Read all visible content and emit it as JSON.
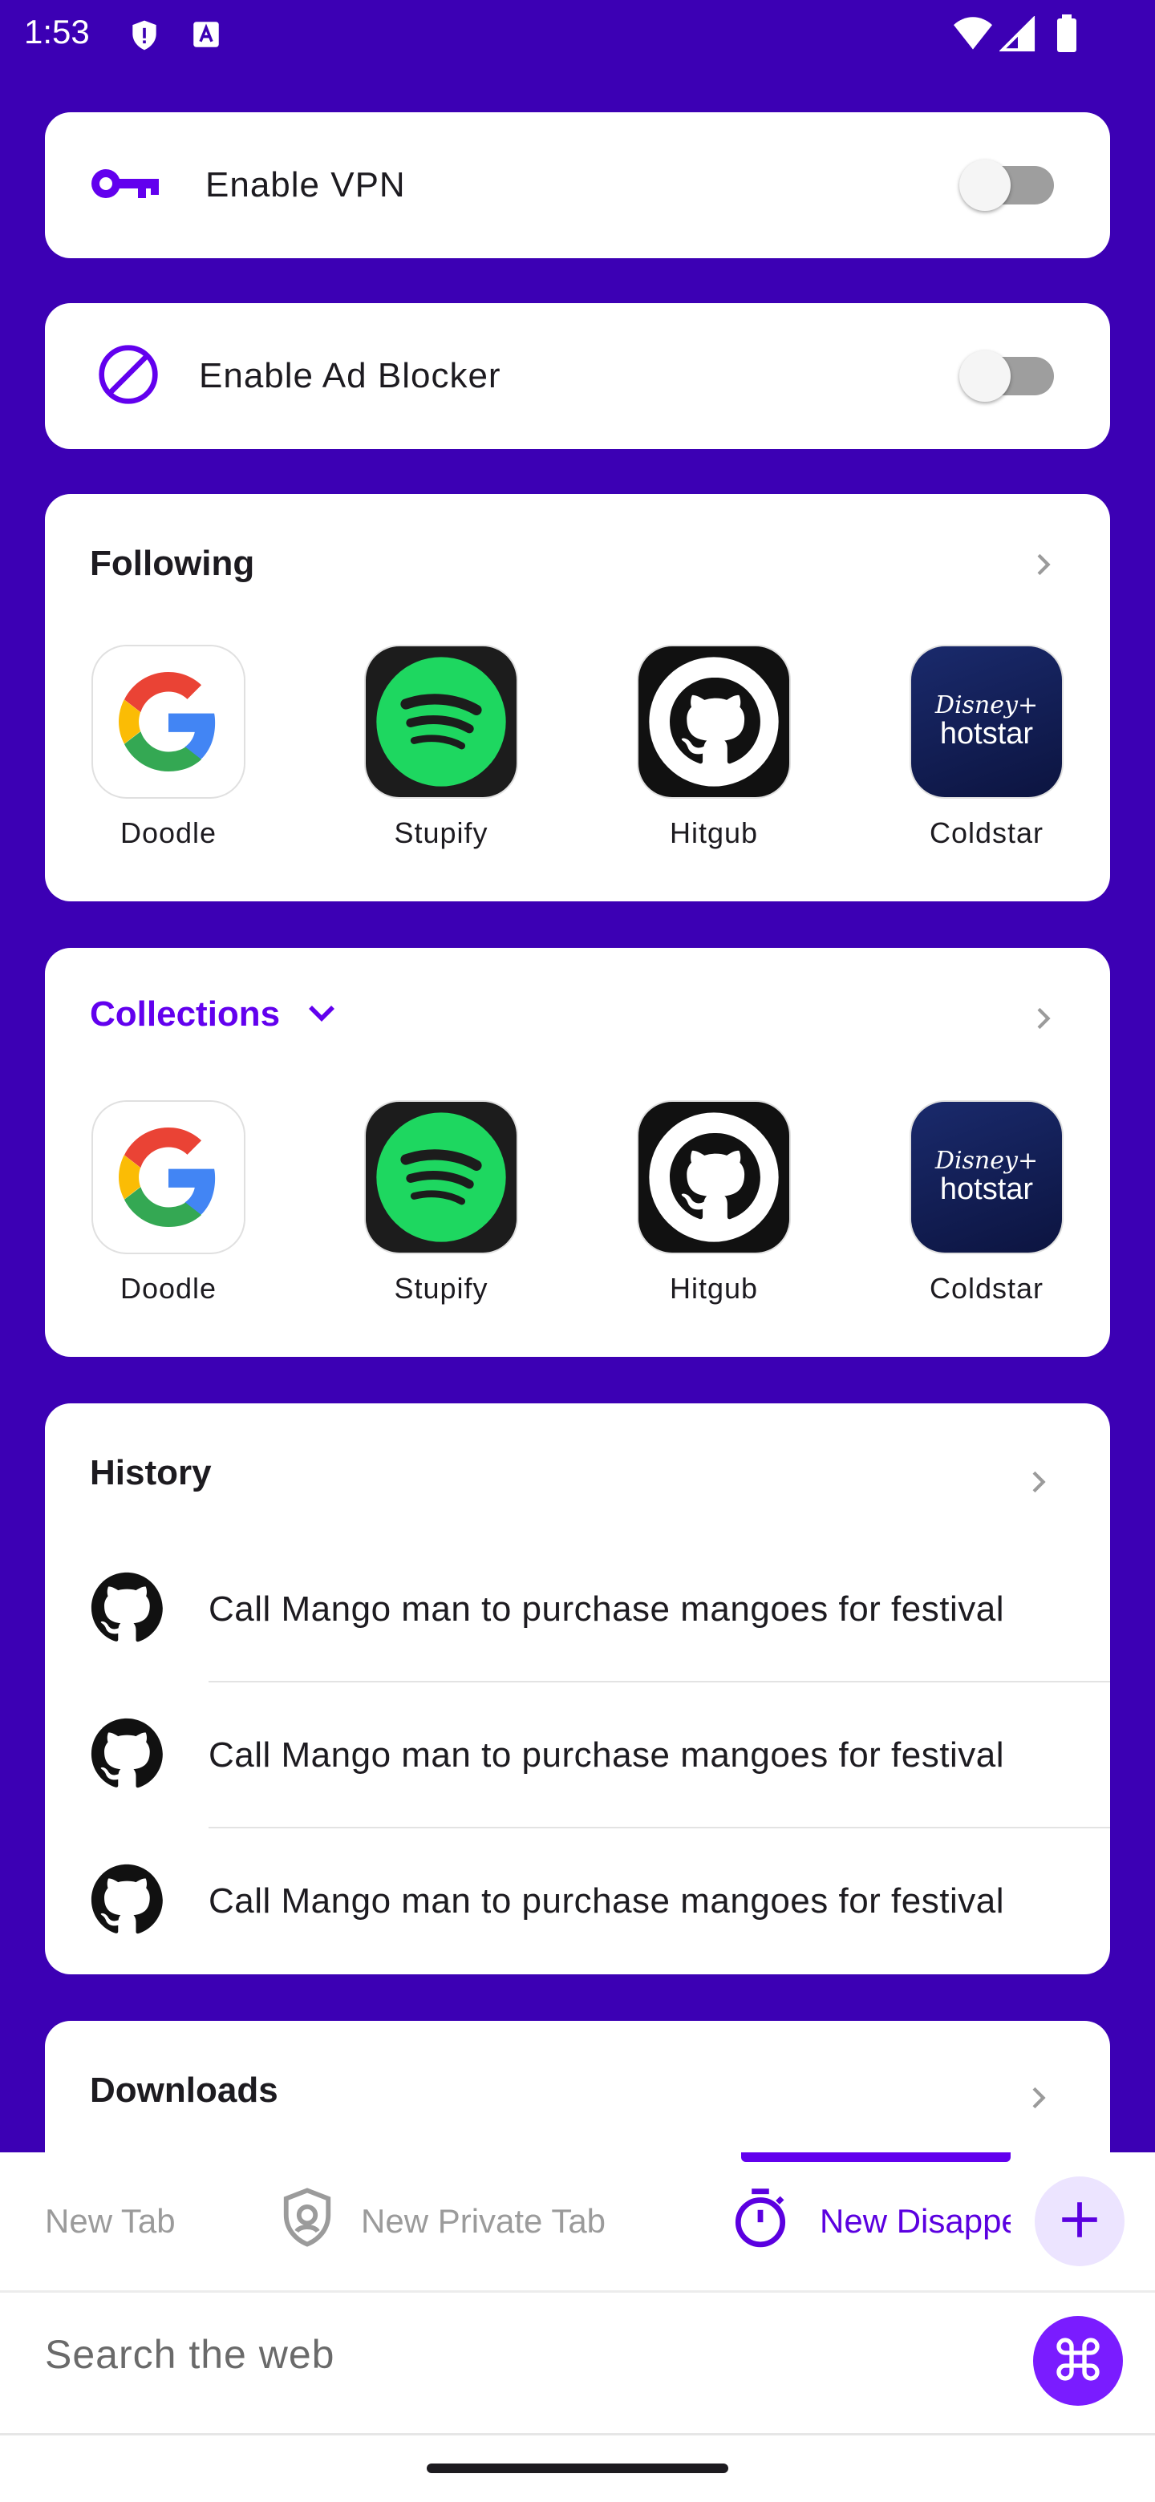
{
  "status_bar": {
    "time": "1:53"
  },
  "vpn": {
    "label": "Enable VPN",
    "enabled": false
  },
  "ad_blocker": {
    "label": "Enable Ad Blocker",
    "enabled": false
  },
  "following": {
    "title": "Following",
    "apps": [
      {
        "label": "Doodle",
        "icon": "google-icon"
      },
      {
        "label": "Stupify",
        "icon": "spotify-icon"
      },
      {
        "label": "Hitgub",
        "icon": "github-icon"
      },
      {
        "label": "Coldstar",
        "icon": "hotstar-icon"
      }
    ]
  },
  "collections": {
    "title": "Collections",
    "apps": [
      {
        "label": "Doodle",
        "icon": "google-icon"
      },
      {
        "label": "Stupify",
        "icon": "spotify-icon"
      },
      {
        "label": "Hitgub",
        "icon": "github-icon"
      },
      {
        "label": "Coldstar",
        "icon": "hotstar-icon"
      }
    ]
  },
  "history": {
    "title": "History",
    "items": [
      {
        "text": "Call Mango man to purchase mangoes for festival",
        "icon": "github-icon"
      },
      {
        "text": "Call Mango man to purchase mangoes for festival",
        "icon": "github-icon"
      },
      {
        "text": "Call Mango man to purchase mangoes for festival",
        "icon": "github-icon"
      }
    ]
  },
  "downloads": {
    "title": "Downloads"
  },
  "tabs": {
    "new_tab": "New Tab",
    "new_private_tab": "New Private Tab",
    "new_disappearing_tab": "New Disappearing Tab"
  },
  "search": {
    "placeholder": "Search the web"
  },
  "hotstar_logo_text": {
    "brand": "Disney+",
    "name": "hotstar"
  },
  "colors": {
    "accent": "#6200ee",
    "background": "#3c00b4",
    "spotify": "#1ed760"
  }
}
